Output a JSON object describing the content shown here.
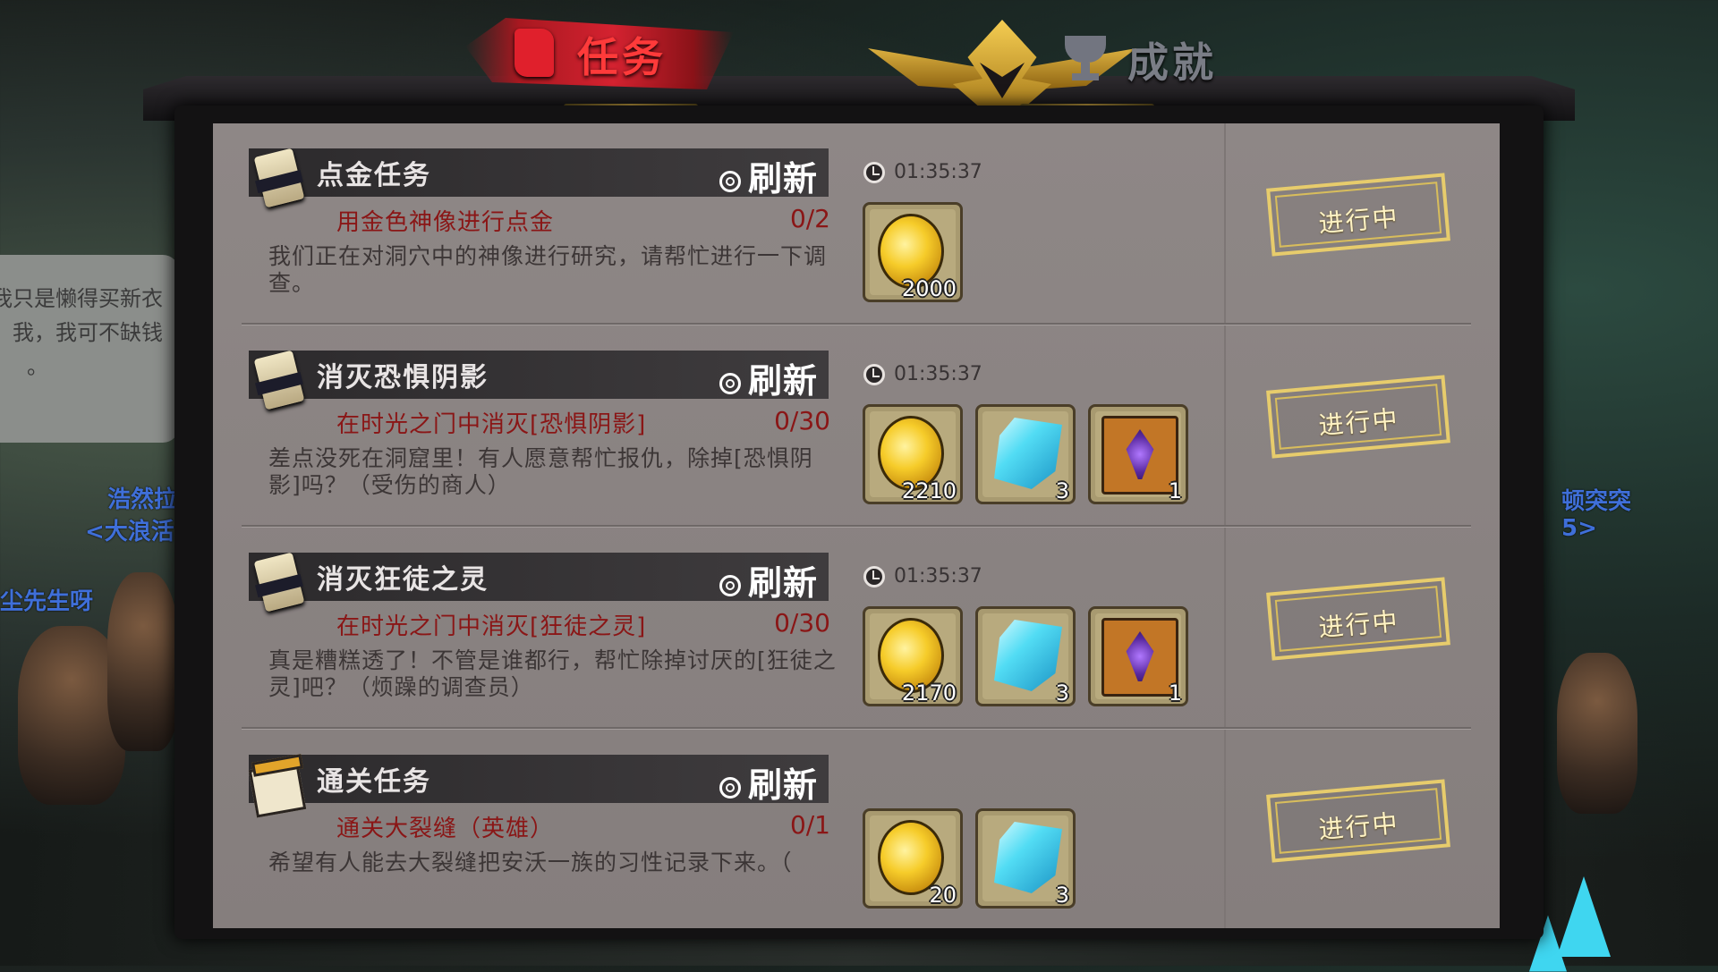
{
  "tabs": {
    "active": "任务",
    "inactive": "成就"
  },
  "background": {
    "bubble_lines": [
      "我只是懒得买新衣",
      "，我，我可不缺钱",
      "。"
    ],
    "names_left": [
      "浩然拉",
      "<大浪活",
      "尘先生呀"
    ],
    "names_right": [
      "顿突突",
      "5>"
    ]
  },
  "quests": [
    {
      "icon": "scroll-icon",
      "title": "点金任务",
      "refresh": "刷新",
      "objective": "用金色神像进行点金",
      "progress": "0/2",
      "desc": "我们正在对洞穴中的神像进行研究，请帮忙进行一下调查。",
      "timer": "01:35:37",
      "rewards": [
        {
          "type": "gold-coin-icon",
          "qty": "2000"
        }
      ],
      "status": "进行中"
    },
    {
      "icon": "scroll-icon",
      "title": "消灭恐惧阴影",
      "refresh": "刷新",
      "objective": "在时光之门中消灭[恐惧阴影]",
      "progress": "0/30",
      "desc": "差点没死在洞窟里！有人愿意帮忙报仇，除掉[恐惧阴影]吗？（受伤的商人）",
      "timer": "01:35:37",
      "rewards": [
        {
          "type": "gold-coin-icon",
          "qty": "2210"
        },
        {
          "type": "blue-gem-icon",
          "qty": "3"
        },
        {
          "type": "spellbook-icon",
          "qty": "1"
        }
      ],
      "status": "进行中"
    },
    {
      "icon": "scroll-icon",
      "title": "消灭狂徒之灵",
      "refresh": "刷新",
      "objective": "在时光之门中消灭[狂徒之灵]",
      "progress": "0/30",
      "desc": "真是糟糕透了！不管是谁都行，帮忙除掉讨厌的[狂徒之灵]吧？（烦躁的调查员）",
      "timer": "01:35:37",
      "rewards": [
        {
          "type": "gold-coin-icon",
          "qty": "2170"
        },
        {
          "type": "blue-gem-icon",
          "qty": "3"
        },
        {
          "type": "spellbook-icon",
          "qty": "1"
        }
      ],
      "status": "进行中"
    },
    {
      "icon": "calendar-icon",
      "title": "通关任务",
      "refresh": "刷新",
      "objective": "通关大裂缝（英雄）",
      "progress": "0/1",
      "desc": "希望有人能去大裂缝把安沃一族的习性记录下来。（",
      "timer": "",
      "rewards": [
        {
          "type": "gold-coin-icon",
          "qty": "20"
        },
        {
          "type": "blue-gem-icon",
          "qty": "3"
        }
      ],
      "status": "进行中"
    }
  ],
  "colors": {
    "active_tab": "#d42230",
    "panel_bg": "#8c8584",
    "objective_text": "#8a1616",
    "status_border": "#e7cc6c"
  }
}
